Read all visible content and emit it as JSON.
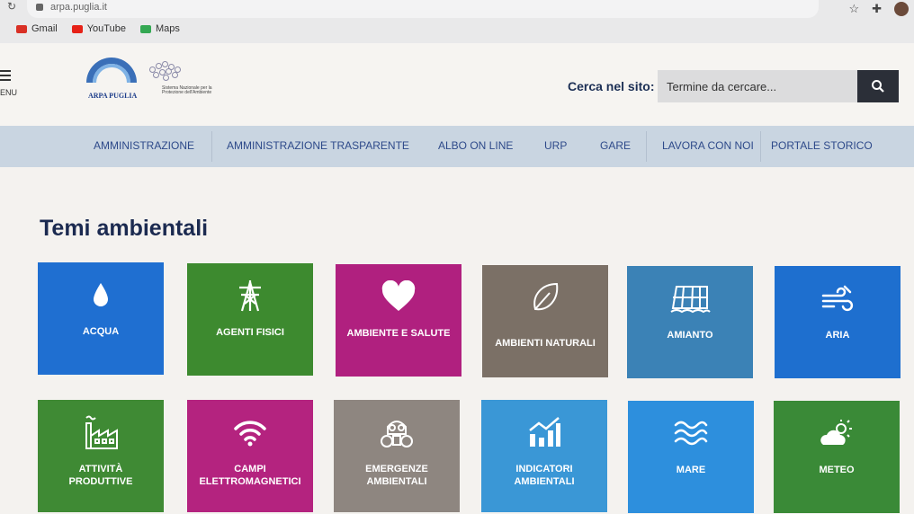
{
  "browser": {
    "url": "arpa.puglia.it",
    "bookmarks": [
      {
        "label": "Gmail",
        "icon": "gmail-icon",
        "color": "#d93025"
      },
      {
        "label": "YouTube",
        "icon": "youtube-icon",
        "color": "#e62117"
      },
      {
        "label": "Maps",
        "icon": "maps-icon",
        "color": "#34a853"
      }
    ]
  },
  "header": {
    "menu_label": "ENU",
    "logo_text": "ARPA PUGLIA",
    "logo_subtext": "Sistema Nazionale per la Protezione dell'Ambiente",
    "search_label": "Cerca nel sito:",
    "search_placeholder": "Termine da cercare..."
  },
  "nav": [
    "AMMINISTRAZIONE",
    "AMMINISTRAZIONE TRASPARENTE",
    "ALBO ON LINE",
    "URP",
    "GARE",
    "LAVORA CON NOI",
    "PORTALE STORICO"
  ],
  "main": {
    "title": "Temi ambientali",
    "tiles": [
      {
        "label": "ACQUA",
        "icon": "water-drop-icon",
        "color": "#1f6fd1"
      },
      {
        "label": "AGENTI FISICI",
        "icon": "power-tower-icon",
        "color": "#3d8a2f"
      },
      {
        "label": "AMBIENTE E SALUTE",
        "icon": "heart-icon",
        "color": "#b0207f"
      },
      {
        "label": "AMBIENTI NATURALI",
        "icon": "leaf-icon",
        "color": "#7b7066"
      },
      {
        "label": "AMIANTO",
        "icon": "roof-tiles-icon",
        "color": "#3b82b6"
      },
      {
        "label": "ARIA",
        "icon": "wind-icon",
        "color": "#1e6fcf"
      },
      {
        "label": "ATTIVITÀ PRODUTTIVE",
        "icon": "factory-icon",
        "color": "#3f8a34"
      },
      {
        "label": "CAMPI ELETTROMAGNETICI",
        "icon": "wifi-icon",
        "color": "#b4237f"
      },
      {
        "label": "EMERGENZE AMBIENTALI",
        "icon": "gas-mask-icon",
        "color": "#8e8680"
      },
      {
        "label": "INDICATORI AMBIENTALI",
        "icon": "chart-icon",
        "color": "#3a97d6"
      },
      {
        "label": "MARE",
        "icon": "waves-icon",
        "color": "#2d8fdd"
      },
      {
        "label": "METEO",
        "icon": "weather-icon",
        "color": "#3a8a37"
      }
    ]
  }
}
